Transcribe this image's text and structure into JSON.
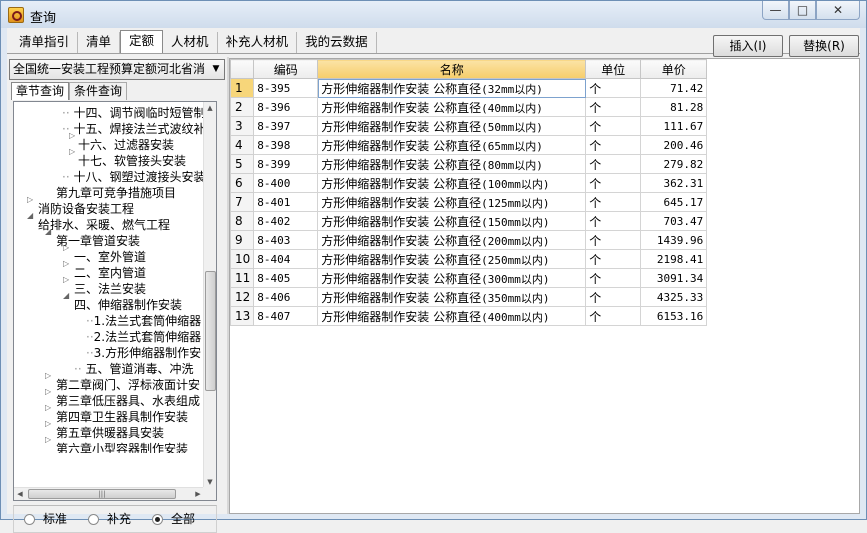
{
  "window": {
    "title": "查询",
    "minimize_icon": "minimize-icon",
    "maximize_icon": "maximize-icon",
    "close_icon": "close-icon"
  },
  "tabs": [
    {
      "label": "清单指引"
    },
    {
      "label": "清单"
    },
    {
      "label": "定额"
    },
    {
      "label": "人材机"
    },
    {
      "label": "补充人材机"
    },
    {
      "label": "我的云数据"
    }
  ],
  "active_tab": "定额",
  "buttons": {
    "insert": "插入(I)",
    "replace": "替换(R)"
  },
  "left": {
    "library": "全国统一安装工程预算定额河北省消",
    "subtabs": [
      {
        "label": "章节查询"
      },
      {
        "label": "条件查询"
      }
    ],
    "tree": [
      {
        "label": "十四、调节阀临时短管制"
      },
      {
        "label": "十五、焊接法兰式波纹补"
      },
      {
        "label": "十六、过滤器安装"
      },
      {
        "label": "十七、软管接头安装"
      },
      {
        "label": "十八、钢塑过渡接头安装"
      },
      {
        "label": "第九章可竞争措施项目"
      },
      {
        "label": "消防设备安装工程"
      },
      {
        "label": "给排水、采暖、燃气工程"
      },
      {
        "label": "第一章管道安装"
      },
      {
        "label": "一、室外管道"
      },
      {
        "label": "二、室内管道"
      },
      {
        "label": "三、法兰安装"
      },
      {
        "label": "四、伸缩器制作安装"
      },
      {
        "label": "1.法兰式套筒伸缩器"
      },
      {
        "label": "2.法兰式套筒伸缩器"
      },
      {
        "label": "3.方形伸缩器制作安"
      },
      {
        "label": "五、管道消毒、冲洗"
      },
      {
        "label": "第二章阀门、浮标液面计安"
      },
      {
        "label": "第三章低压器具、水表组成"
      },
      {
        "label": "第四章卫生器具制作安装"
      },
      {
        "label": "第五章供暖器具安装"
      },
      {
        "label": "第六章小型容器制作安装"
      }
    ],
    "radios": [
      {
        "label": "标准"
      },
      {
        "label": "补充"
      },
      {
        "label": "全部"
      }
    ],
    "radio_selected": "全部"
  },
  "grid": {
    "headers": {
      "code": "编码",
      "name": "名称",
      "unit": "单位",
      "price": "单价"
    },
    "rows": [
      {
        "n": "1",
        "code": "8-395",
        "name": "方形伸缩器制作安装 公称直径",
        "spec": "(32mm以内)",
        "unit": "个",
        "price": "71.42"
      },
      {
        "n": "2",
        "code": "8-396",
        "name": "方形伸缩器制作安装 公称直径",
        "spec": "(40mm以内)",
        "unit": "个",
        "price": "81.28"
      },
      {
        "n": "3",
        "code": "8-397",
        "name": "方形伸缩器制作安装 公称直径",
        "spec": "(50mm以内)",
        "unit": "个",
        "price": "111.67"
      },
      {
        "n": "4",
        "code": "8-398",
        "name": "方形伸缩器制作安装 公称直径",
        "spec": "(65mm以内)",
        "unit": "个",
        "price": "200.46"
      },
      {
        "n": "5",
        "code": "8-399",
        "name": "方形伸缩器制作安装 公称直径",
        "spec": "(80mm以内)",
        "unit": "个",
        "price": "279.82"
      },
      {
        "n": "6",
        "code": "8-400",
        "name": "方形伸缩器制作安装 公称直径",
        "spec": "(100mm以内)",
        "unit": "个",
        "price": "362.31"
      },
      {
        "n": "7",
        "code": "8-401",
        "name": "方形伸缩器制作安装 公称直径",
        "spec": "(125mm以内)",
        "unit": "个",
        "price": "645.17"
      },
      {
        "n": "8",
        "code": "8-402",
        "name": "方形伸缩器制作安装 公称直径",
        "spec": "(150mm以内)",
        "unit": "个",
        "price": "703.47"
      },
      {
        "n": "9",
        "code": "8-403",
        "name": "方形伸缩器制作安装 公称直径",
        "spec": "(200mm以内)",
        "unit": "个",
        "price": "1439.96"
      },
      {
        "n": "10",
        "code": "8-404",
        "name": "方形伸缩器制作安装 公称直径",
        "spec": "(250mm以内)",
        "unit": "个",
        "price": "2198.41"
      },
      {
        "n": "11",
        "code": "8-405",
        "name": "方形伸缩器制作安装 公称直径",
        "spec": "(300mm以内)",
        "unit": "个",
        "price": "3091.34"
      },
      {
        "n": "12",
        "code": "8-406",
        "name": "方形伸缩器制作安装 公称直径",
        "spec": "(350mm以内)",
        "unit": "个",
        "price": "4325.33"
      },
      {
        "n": "13",
        "code": "8-407",
        "name": "方形伸缩器制作安装 公称直径",
        "spec": "(400mm以内)",
        "unit": "个",
        "price": "6153.16"
      }
    ],
    "selected_row": "1"
  }
}
